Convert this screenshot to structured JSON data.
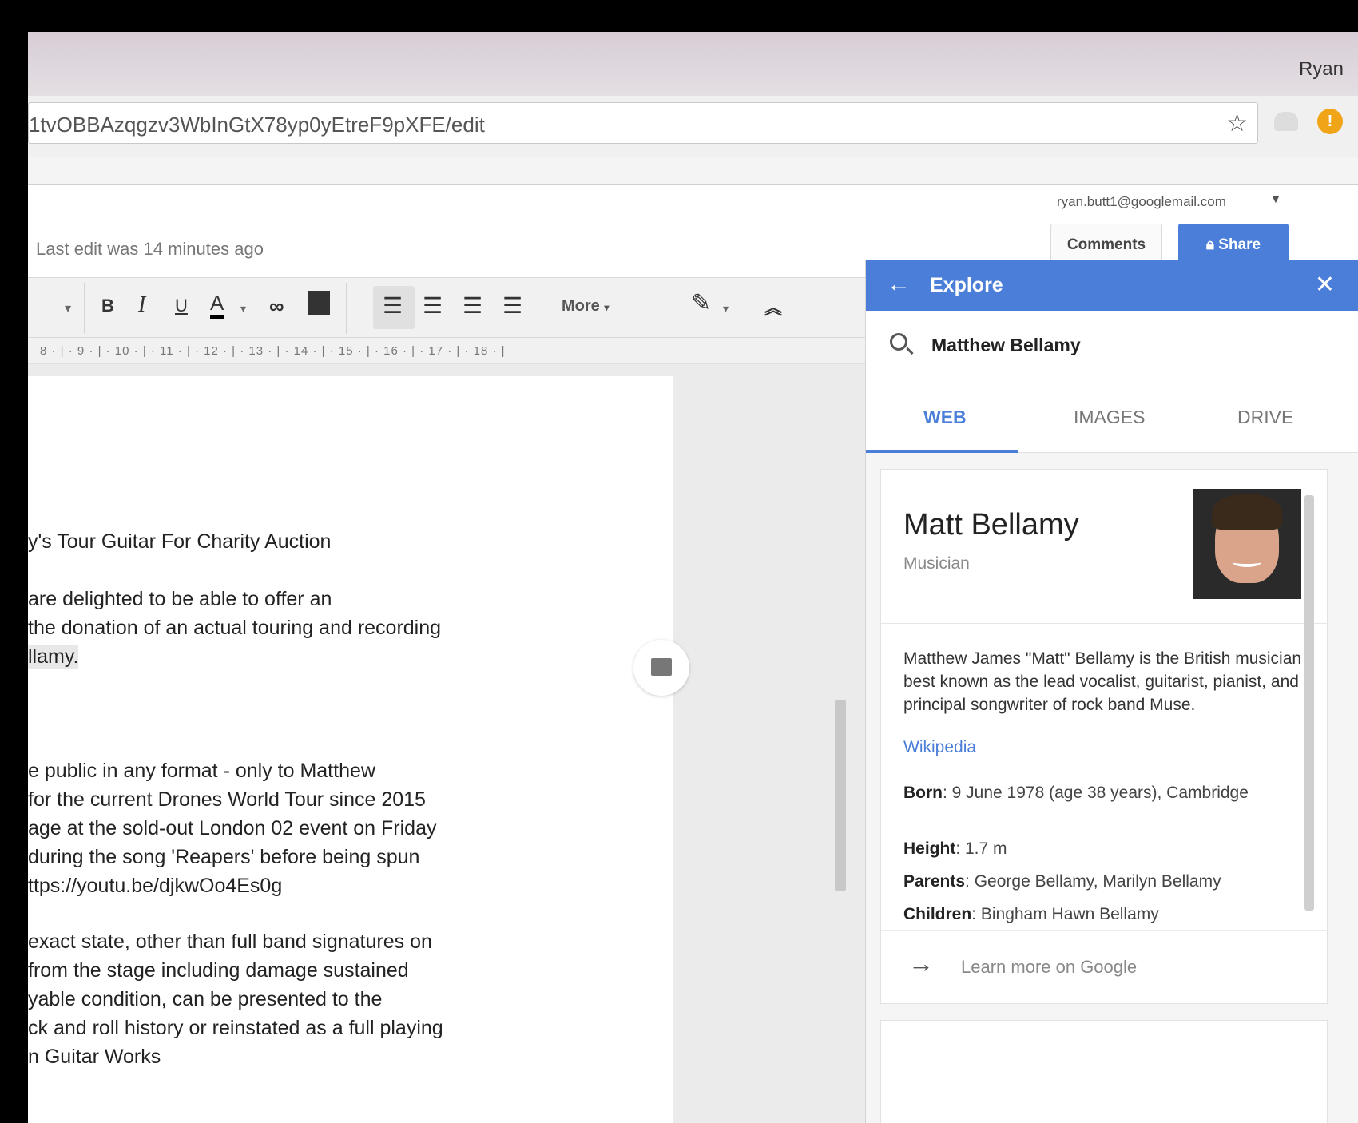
{
  "browser": {
    "profile_name": "Ryan",
    "url": "1tvOBBAzqgzv3WbInGtX78yp0yEtreF9pXFE/edit"
  },
  "docs": {
    "last_edit": "Last edit was 14 minutes ago",
    "account_email": "ryan.butt1@googlemail.com",
    "comments_label": "Comments",
    "share_label": "Share",
    "toolbar": {
      "bold": "B",
      "italic": "I",
      "underline": "U",
      "text_color": "A",
      "more_label": "More"
    },
    "ruler": "8 · | · 9 · | · 10 · | · 11 · | · 12 · | · 13 · | · 14 · | · 15 · | · 16 · | · 17 · | · 18 · |",
    "lines": [
      "y's Tour Guitar For Charity Auction",
      "are delighted to be able to offer an",
      "the donation of an actual touring and recording",
      "llamy.",
      "e public in any format - only to Matthew",
      " for the current Drones World Tour since 2015",
      "age at the sold-out London 02 event on Friday",
      " during the song 'Reapers' before being spun",
      "ttps://youtu.be/djkwOo4Es0g",
      "exact state, other than full band signatures on",
      " from the stage including damage sustained",
      "yable condition, can be presented to the",
      "ck and roll history or reinstated as a full playing",
      "n Guitar Works"
    ]
  },
  "explore": {
    "title": "Explore",
    "query": "Matthew Bellamy",
    "tabs": [
      "WEB",
      "IMAGES",
      "DRIVE"
    ],
    "card": {
      "name": "Matt Bellamy",
      "subtitle": "Musician",
      "description": "Matthew James \"Matt\" Bellamy is the British musician best known as the lead vocalist, guitarist, pianist, and principal songwriter of rock band Muse.",
      "source": "Wikipedia",
      "facts": [
        {
          "label": "Born",
          "value": ": 9 June 1978 (age 38 years), Cambridge"
        },
        {
          "label": "Height",
          "value": ": 1.7 m"
        },
        {
          "label": "Parents",
          "value": ": George Bellamy, Marilyn Bellamy"
        },
        {
          "label": "Children",
          "value": ": Bingham Hawn Bellamy"
        }
      ],
      "learn_more": "Learn more on Google"
    }
  },
  "colors": {
    "accent": "#4a7ed8",
    "warning": "#f0a417"
  }
}
